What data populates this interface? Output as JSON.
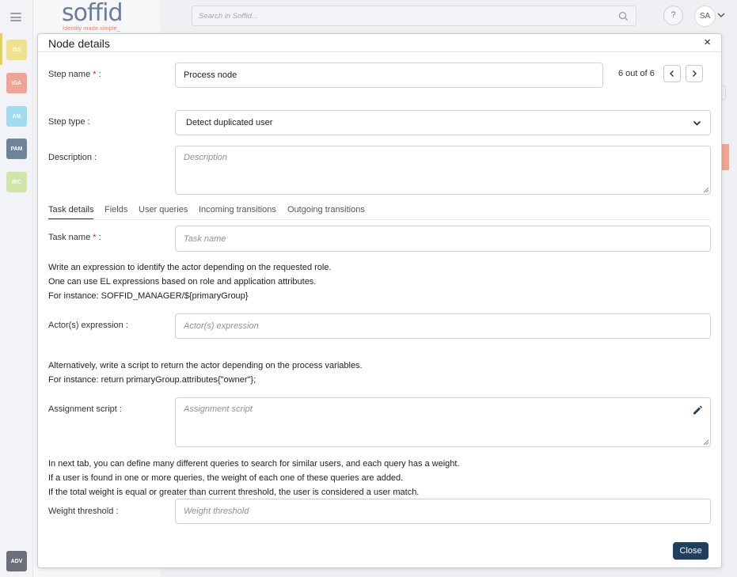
{
  "app": {
    "logo_text": "soffid",
    "logo_tagline": "Identity made simple_",
    "search_placeholder": "Search in Soffid...",
    "help_label": "?",
    "user_initials": "SA",
    "rail": [
      {
        "label": "ISS",
        "color": "#f0dc6a"
      },
      {
        "label": "IGA",
        "color": "#ee8a78"
      },
      {
        "label": "AM",
        "color": "#87d3ec"
      },
      {
        "label": "PAM",
        "color": "#3f5f7a"
      },
      {
        "label": "IRC",
        "color": "#c7e18f"
      }
    ],
    "rail_bottom": {
      "label": "ADV",
      "color": "#6b7078"
    }
  },
  "modal": {
    "title": "Node details",
    "close_icon": "×",
    "step_name": {
      "label": "Step name",
      "required": "*",
      "suffix": " :",
      "value": "Process node"
    },
    "counter": "6 out of 6",
    "step_type": {
      "label": "Step type :",
      "value": "Detect duplicated user"
    },
    "description": {
      "label": "Description :",
      "placeholder": "Description"
    },
    "tabs": [
      {
        "label": "Task details",
        "active": true
      },
      {
        "label": "Fields",
        "active": false
      },
      {
        "label": "User queries",
        "active": false
      },
      {
        "label": "Incoming transitions",
        "active": false
      },
      {
        "label": "Outgoing transitions",
        "active": false
      }
    ],
    "task_name": {
      "label": "Task name",
      "required": "*",
      "suffix": " :",
      "placeholder": "Task name"
    },
    "actor_help": [
      "Write an expression to identify the actor depending on the requested role.",
      "One can use EL expressions based on role and application attributes.",
      "For instance: SOFFID_MANAGER/${primaryGroup}"
    ],
    "actor_expression": {
      "label": "Actor(s) expression :",
      "placeholder": "Actor(s) expression"
    },
    "script_help": [
      "Alternatively, write a script to return the actor depending on the process variables.",
      "For instance: return primaryGroup.attributes{\"owner\"};"
    ],
    "assignment_script": {
      "label": "Assignment script :",
      "placeholder": "Assignment script"
    },
    "weight_help": [
      "In next tab, you can define many different queries to search for similar users, and each query has a weight.",
      "If a user is found in one or more queries, the weight of each one of these queries are added.",
      "If the total weight is equal or greater than current threshold, the user is considered a user match."
    ],
    "weight_threshold": {
      "label": "Weight threshold :",
      "placeholder": "Weight threshold"
    },
    "close_button": "Close"
  }
}
